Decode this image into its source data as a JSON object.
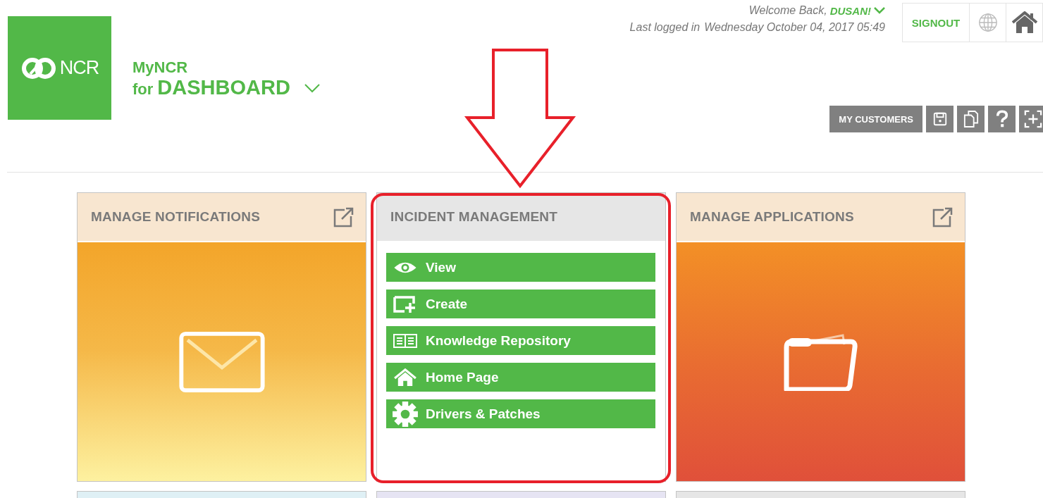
{
  "logo": {
    "text": "NCR"
  },
  "app_title": {
    "line1": "MyNCR",
    "prefix": "for",
    "name": "DASHBOARD"
  },
  "user": {
    "welcome": "Welcome Back,",
    "name": "DUSAN!",
    "last_login_label": "Last logged in",
    "last_login": "Wednesday October 04, 2017 05:49"
  },
  "signout": "SIGNOUT",
  "toolbar": {
    "customers_button": "MY CUSTOMERS",
    "icons": [
      {
        "kind": "save"
      },
      {
        "kind": "copy"
      },
      {
        "kind": "help"
      },
      {
        "kind": "add"
      }
    ]
  },
  "tiles": [
    {
      "kind": "mail",
      "title": "MANAGE NOTIFICATIONS",
      "external_link": true,
      "highlighted": false
    },
    {
      "kind": "links",
      "title": "INCIDENT MANAGEMENT",
      "external_link": false,
      "highlighted": true,
      "links": [
        {
          "kind": "eye",
          "label": "View"
        },
        {
          "kind": "create",
          "label": "Create"
        },
        {
          "kind": "book",
          "label": "Knowledge Repository"
        },
        {
          "kind": "home",
          "label": "Home Page"
        },
        {
          "kind": "gear",
          "label": "Drivers & Patches"
        }
      ]
    },
    {
      "kind": "folder",
      "title": "MANAGE APPLICATIONS",
      "external_link": true,
      "highlighted": false
    }
  ],
  "next_tiles": [
    {
      "color": "#dff0f5"
    },
    {
      "color": "#e6e4f3"
    },
    {
      "color": "#e6e6e6"
    }
  ]
}
